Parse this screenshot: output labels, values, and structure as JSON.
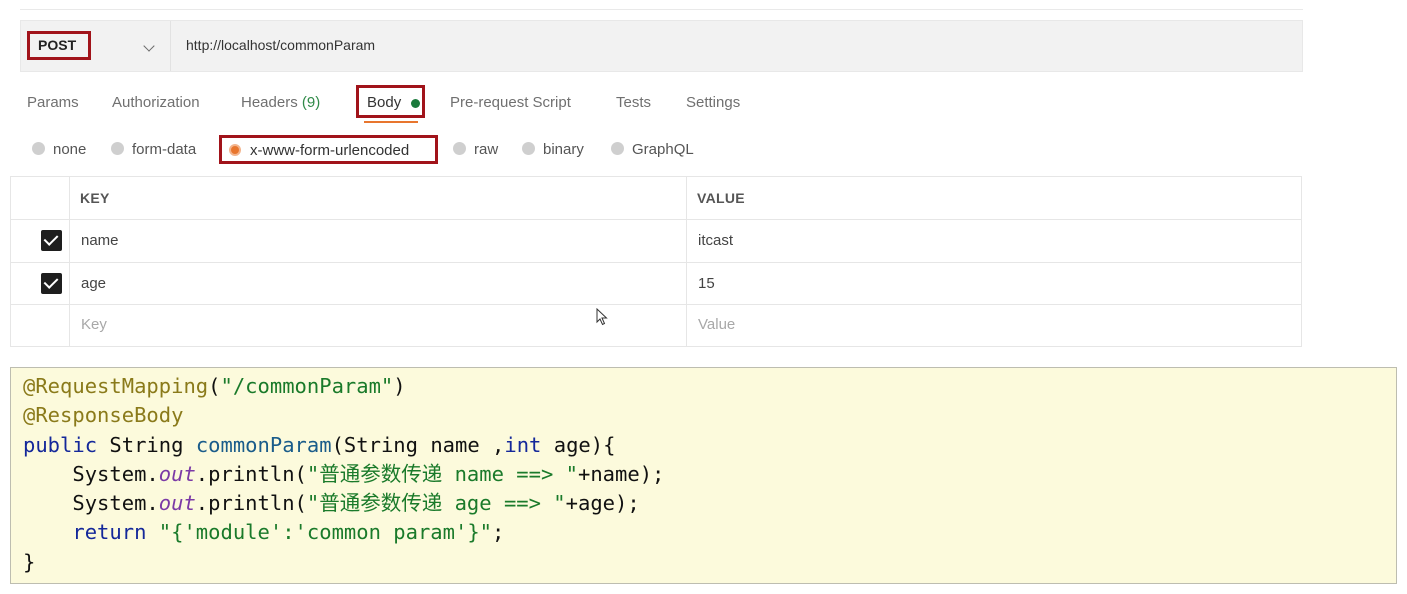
{
  "request": {
    "method": "POST",
    "url": "http://localhost/commonParam"
  },
  "tabs": {
    "params": "Params",
    "authorization": "Authorization",
    "headers": "Headers",
    "headers_count": "(9)",
    "body": "Body",
    "pre_request": "Pre-request Script",
    "tests": "Tests",
    "settings": "Settings",
    "active": "Body"
  },
  "body_types": {
    "none": "none",
    "form_data": "form-data",
    "urlencoded": "x-www-form-urlencoded",
    "raw": "raw",
    "binary": "binary",
    "graphql": "GraphQL",
    "selected": "x-www-form-urlencoded"
  },
  "table": {
    "headers": {
      "key": "KEY",
      "value": "VALUE"
    },
    "rows": [
      {
        "checked": true,
        "key": "name",
        "value": "itcast"
      },
      {
        "checked": true,
        "key": "age",
        "value": "15"
      }
    ],
    "placeholder": {
      "key": "Key",
      "value": "Value"
    }
  },
  "code": {
    "line1_ann": "@RequestMapping",
    "line1_paren_open": "(",
    "line1_str": "\"/commonParam\"",
    "line1_paren_close": ")",
    "line2_ann": "@ResponseBody",
    "line3_kw": "public",
    "line3_a": " String ",
    "line3_fn": "commonParam",
    "line3_b": "(String name ,",
    "line3_kw2": "int",
    "line3_c": " age){",
    "line4_indent": "    System.",
    "line4_out": "out",
    "line4_a": ".println(",
    "line4_str": "\"普通参数传递 name ==> \"",
    "line4_b": "+name);",
    "line5_indent": "    System.",
    "line5_out": "out",
    "line5_a": ".println(",
    "line5_str": "\"普通参数传递 age ==> \"",
    "line5_b": "+age);",
    "line6_indent": "    ",
    "line6_kw": "return",
    "line6_sp": " ",
    "line6_str": "\"{'module':'common param'}\"",
    "line6_end": ";",
    "line7": "}"
  },
  "colors": {
    "highlight_border": "#a1131a",
    "active_tab_underline": "#e8762e",
    "body_dot": "#1b7a3c",
    "code_background": "#fcfadc"
  }
}
